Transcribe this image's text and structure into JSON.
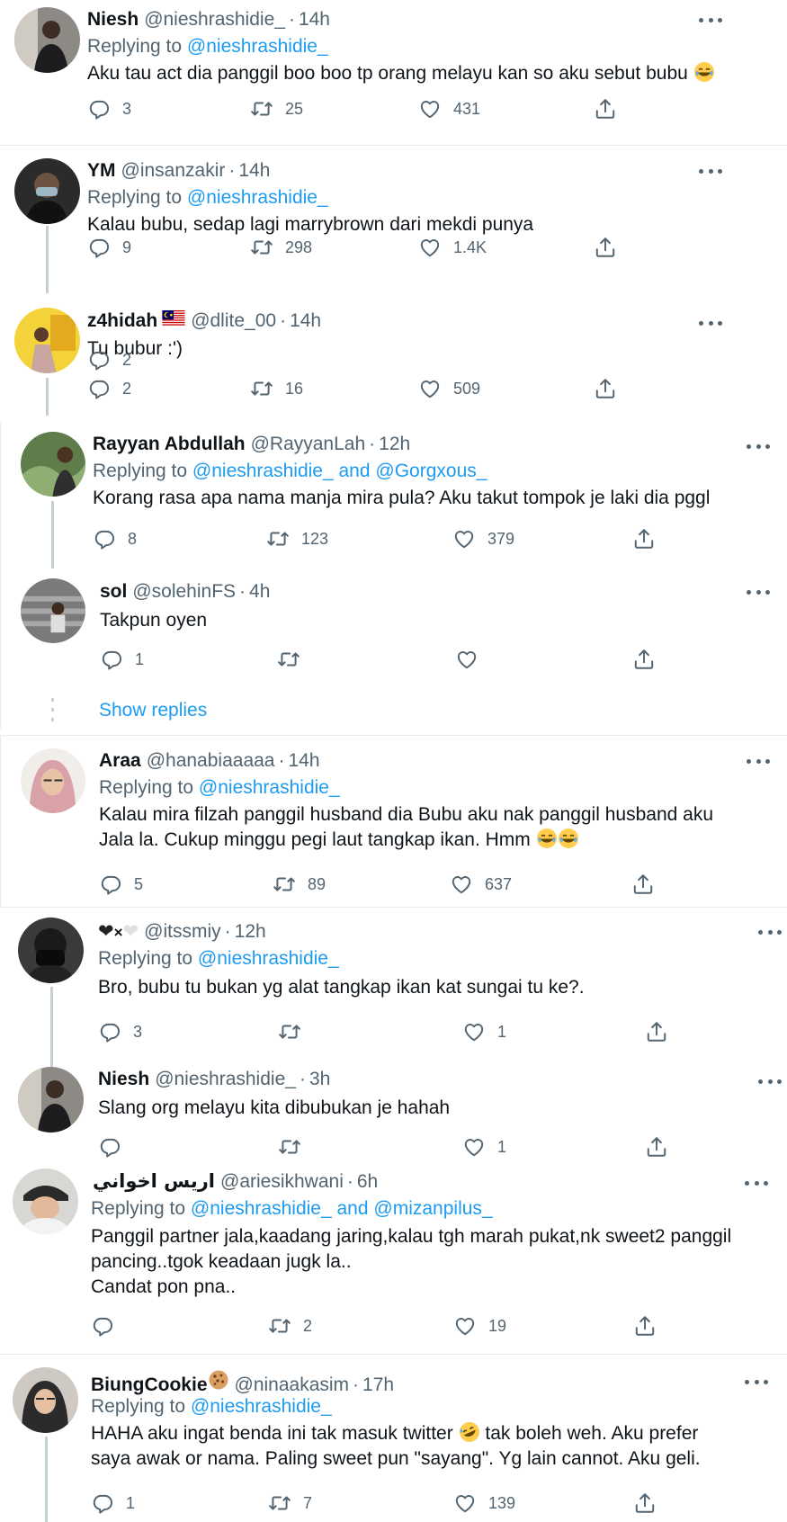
{
  "tweets": [
    {
      "name": "Niesh",
      "handle": "@nieshrashidie_",
      "time": "14h",
      "replying_prefix": "Replying to",
      "replying_to": "@nieshrashidie_",
      "text": "Aku tau act dia panggil boo boo tp orang melayu kan so aku sebut bubu",
      "replies": "3",
      "retweets": "25",
      "likes": "431"
    },
    {
      "name": "YM",
      "handle": "@insanzakir",
      "time": "14h",
      "replying_prefix": "Replying to",
      "replying_to": "@nieshrashidie_",
      "text": "Kalau bubu, sedap lagi marrybrown dari mekdi punya",
      "replies": "9",
      "retweets": "298",
      "likes": "1.4K"
    },
    {
      "name": "z4hidah",
      "handle": "@dlite_00",
      "time": "14h",
      "text": "Tu bubur :')",
      "replies": "2",
      "retweets": "16",
      "likes": "509"
    },
    {
      "name": "Rayyan Abdullah",
      "handle": "@RayyanLah",
      "time": "12h",
      "replying_prefix": "Replying to",
      "replying_to": "@nieshrashidie_",
      "replying_and": "and",
      "replying_to2": "@Gorgxous_",
      "text": "Korang rasa apa nama manja mira pula? Aku takut tompok je laki dia pggl",
      "replies": "8",
      "retweets": "123",
      "likes": "379"
    },
    {
      "name": "sol",
      "handle": "@solehinFS",
      "time": "4h",
      "text": "Takpun oyen",
      "replies": "1",
      "retweets": "",
      "likes": ""
    },
    {
      "name": "Araa",
      "handle": "@hanabiaaaaa",
      "time": "14h",
      "replying_prefix": "Replying to",
      "replying_to": "@nieshrashidie_",
      "text_line1": "Kalau mira filzah panggil husband dia Bubu  aku nak panggil husband aku",
      "text_line2": "Jala la. Cukup minggu pegi laut tangkap ikan. Hmm",
      "replies": "5",
      "retweets": "89",
      "likes": "637"
    },
    {
      "name_sym": "×",
      "handle": "@itssmiy",
      "time": "12h",
      "replying_prefix": "Replying to",
      "replying_to": "@nieshrashidie_",
      "text": "Bro, bubu tu bukan yg alat tangkap ikan kat sungai tu ke?.",
      "replies": "3",
      "retweets": "",
      "likes": "1"
    },
    {
      "name": "Niesh",
      "handle": "@nieshrashidie_",
      "time": "3h",
      "text": "Slang org melayu kita dibubukan je hahah",
      "replies": "",
      "retweets": "",
      "likes": "1"
    },
    {
      "name": "اريس اخواني",
      "handle": "@ariesikhwani",
      "time": "6h",
      "replying_prefix": "Replying to",
      "replying_to": "@nieshrashidie_",
      "replying_and": "and",
      "replying_to2": "@mizanpilus_",
      "text_line1": "Panggil partner jala,kaadang jaring,kalau tgh marah pukat,nk sweet2 panggil",
      "text_line2": "pancing..tgok keadaan jugk la..",
      "text_line3": "Candat pon pna..",
      "replies": "",
      "retweets": "2",
      "likes": "19"
    },
    {
      "name": "BiungCookie",
      "handle": "@ninaakasim",
      "time": "17h",
      "replying_prefix": "Replying to",
      "replying_to": "@nieshrashidie_",
      "text_line1a": "HAHA aku ingat benda ini tak masuk twitter",
      "text_line1b": "tak boleh weh. Aku prefer",
      "text_line2": "saya awak or nama. Paling sweet pun \"sayang\". Yg lain cannot. Aku geli.",
      "replies": "1",
      "retweets": "7",
      "likes": "139"
    }
  ],
  "show_replies": "Show replies",
  "colors": {
    "accent": "#1d9bf0",
    "secondary_text": "#536471",
    "thread_line": "#c4cfd6"
  },
  "icons": {
    "reply": "reply-icon",
    "retweet": "retweet-icon",
    "like": "heart-icon",
    "share": "share-icon",
    "more": "more-icon"
  }
}
